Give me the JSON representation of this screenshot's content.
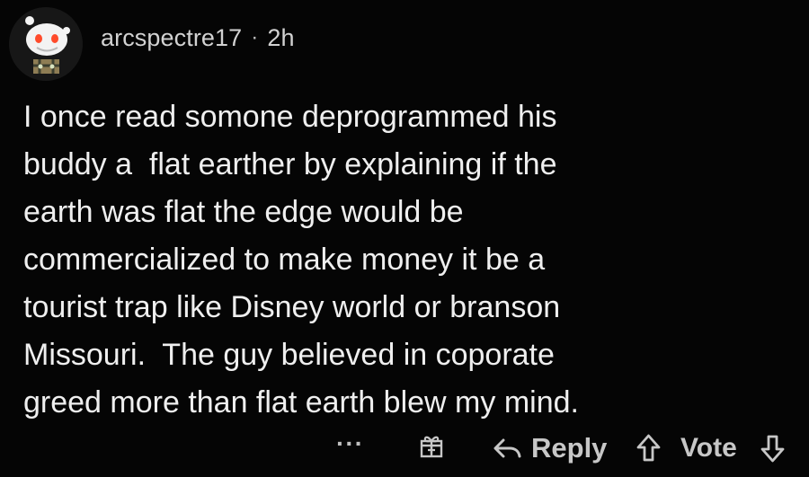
{
  "comment": {
    "username": "arcspectre17",
    "separator": "·",
    "time": "2h",
    "body_lines": [
      "I once read somone deprogrammed his",
      "buddy a  flat earther by explaining if the",
      "earth was flat the edge would be",
      "commercialized to make money it be a",
      "tourist trap like Disney world or branson",
      "Missouri.  The guy believed in coporate",
      "greed more than flat earth blew my mind."
    ]
  },
  "actions": {
    "more_label": "···",
    "gift_icon": "gift-icon",
    "reply_label": "Reply",
    "reply_icon": "reply-arrow-icon",
    "vote_label": "Vote",
    "upvote_icon": "upvote-arrow-icon",
    "downvote_icon": "downvote-arrow-icon"
  },
  "colors": {
    "background": "#050505",
    "text": "#efefef",
    "secondary_text": "#c7c7c7"
  }
}
